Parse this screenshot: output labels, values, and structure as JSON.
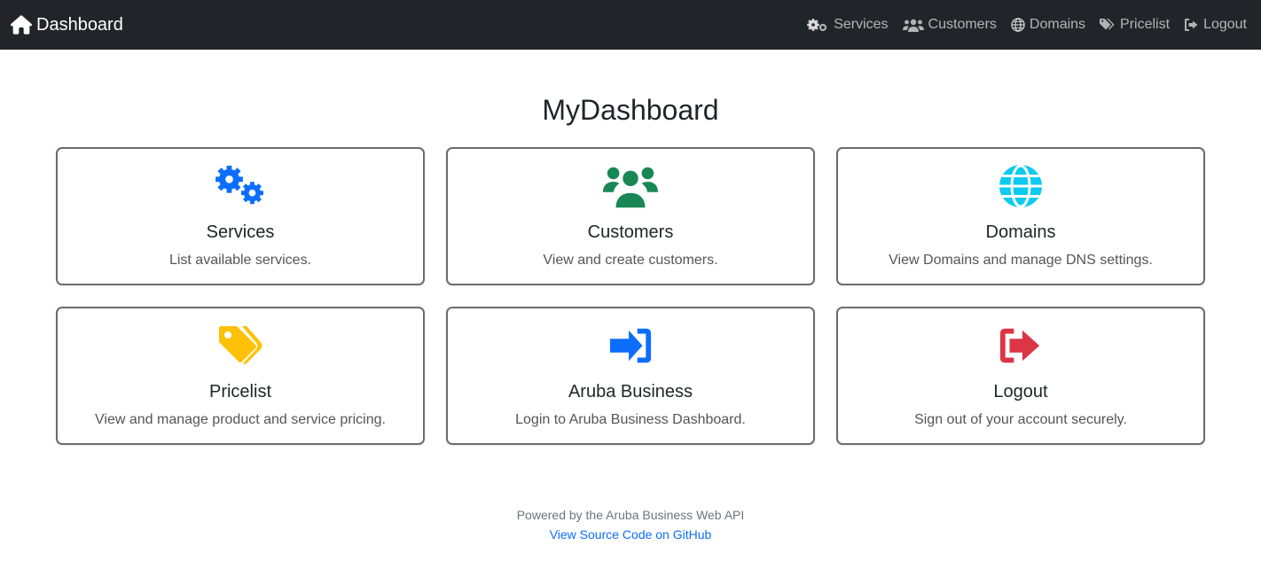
{
  "navbar": {
    "brand": "Dashboard",
    "links": [
      {
        "label": "Services",
        "icon": "gears-icon"
      },
      {
        "label": "Customers",
        "icon": "users-icon"
      },
      {
        "label": "Domains",
        "icon": "globe-icon"
      },
      {
        "label": "Pricelist",
        "icon": "tags-icon"
      },
      {
        "label": "Logout",
        "icon": "logout-icon"
      }
    ]
  },
  "main": {
    "title": "MyDashboard",
    "cards": [
      {
        "title": "Services",
        "description": "List available services.",
        "icon": "gears-icon",
        "color": "#0d6efd"
      },
      {
        "title": "Customers",
        "description": "View and create customers.",
        "icon": "users-icon",
        "color": "#198754"
      },
      {
        "title": "Domains",
        "description": "View Domains and manage DNS settings.",
        "icon": "globe-icon",
        "color": "#0dcaf0"
      },
      {
        "title": "Pricelist",
        "description": "View and manage product and service pricing.",
        "icon": "tags-icon",
        "color": "#ffc107"
      },
      {
        "title": "Aruba Business",
        "description": "Login to Aruba Business Dashboard.",
        "icon": "login-icon",
        "color": "#0d6efd"
      },
      {
        "title": "Logout",
        "description": "Sign out of your account securely.",
        "icon": "logout-icon",
        "color": "#dc3545"
      }
    ]
  },
  "footer": {
    "powered_by": "Powered by the Aruba Business Web API",
    "source_link": "View Source Code on GitHub"
  }
}
